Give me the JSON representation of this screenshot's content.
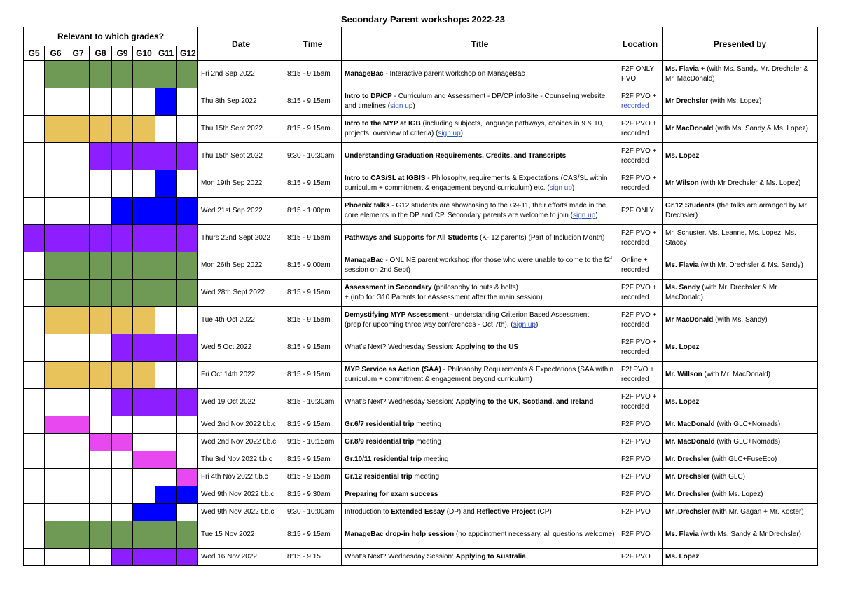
{
  "title": "Secondary Parent workshops 2022-23",
  "headers": {
    "relevant": "Relevant to which grades?",
    "grades": [
      "G5",
      "G6",
      "G7",
      "G8",
      "G9",
      "G10",
      "G11",
      "G12"
    ],
    "date": "Date",
    "time": "Time",
    "title": "Title",
    "location": "Location",
    "presented_by": "Presented by"
  },
  "colors": {
    "g": "#6f9a55",
    "y": "#e8c25b",
    "p": "#8d1eff",
    "b": "#0000ff",
    "m": "#e848ef",
    "link": "#2b4fbf"
  },
  "rows": [
    {
      "tall": true,
      "cells": [
        "w",
        "g",
        "g",
        "g",
        "g",
        "g",
        "g",
        "g"
      ],
      "date": "Fri 2nd Sep 2022",
      "time": "8:15 - 9:15am",
      "title": [
        {
          "t": "ManageBac",
          "s": "b"
        },
        {
          "t": " - Interactive parent workshop on ManageBac"
        }
      ],
      "location": [
        {
          "t": "F2F ONLY PVO"
        }
      ],
      "presenter": [
        {
          "t": "Ms. Flavia",
          "s": "b"
        },
        {
          "t": " + (with Ms. Sandy, Mr. Drechsler & Mr. MacDonald)"
        }
      ]
    },
    {
      "tall": true,
      "cells": [
        "w",
        "w",
        "w",
        "w",
        "w",
        "w",
        "b",
        "w"
      ],
      "date": "Thu 8th Sep 2022",
      "time": "8:15 - 9:15am",
      "title": [
        {
          "t": "Intro to DP/CP",
          "s": "b"
        },
        {
          "t": " - Curriculum and Assessment - DP/CP infoSite - Counseling website and timelines ("
        },
        {
          "t": "sign up",
          "s": "l"
        },
        {
          "t": ")"
        }
      ],
      "location": [
        {
          "t": "F2F PVO + "
        },
        {
          "t": "recorded",
          "s": "l"
        }
      ],
      "presenter": [
        {
          "t": "Mr Drechsler",
          "s": "b"
        },
        {
          "t": " (with Ms. Lopez)"
        }
      ]
    },
    {
      "tall": true,
      "cells": [
        "w",
        "y",
        "y",
        "y",
        "y",
        "y",
        "w",
        "w"
      ],
      "date": "Thu 15th Sept 2022",
      "time": "8:15 - 9:15am",
      "title": [
        {
          "t": "Intro to the MYP at IGB",
          "s": "b"
        },
        {
          "t": " (including subjects, language pathways, choices in 9 & 10, projects, overview of criteria) ("
        },
        {
          "t": "sign up",
          "s": "l"
        },
        {
          "t": ")"
        }
      ],
      "location": [
        {
          "t": "F2F PVO + recorded"
        }
      ],
      "presenter": [
        {
          "t": "Mr MacDonald",
          "s": "b"
        },
        {
          "t": " (with Ms. Sandy &  Ms. Lopez)"
        }
      ]
    },
    {
      "tall": true,
      "cells": [
        "w",
        "w",
        "w",
        "p",
        "p",
        "p",
        "p",
        "p"
      ],
      "date": "Thu 15th Sept 2022",
      "time": "9:30 - 10:30am",
      "title": [
        {
          "t": "Understanding Graduation Requirements, Credits, and Transcripts",
          "s": "b"
        }
      ],
      "location": [
        {
          "t": "F2F PVO + recorded"
        }
      ],
      "presenter": [
        {
          "t": "Ms. Lopez",
          "s": "b"
        }
      ]
    },
    {
      "tall": true,
      "cells": [
        "w",
        "w",
        "w",
        "w",
        "w",
        "w",
        "b",
        "w"
      ],
      "date": "Mon 19th Sep 2022",
      "time": "8:15 - 9:15am",
      "title": [
        {
          "t": "Intro to CAS/SL at IGBIS",
          "s": "b"
        },
        {
          "t": " - Philosophy, requirements & Expectations (CAS/SL within curriculum + commitment & engagement beyond curriculum) etc. ("
        },
        {
          "t": "sign up",
          "s": "l"
        },
        {
          "t": ")"
        }
      ],
      "location": [
        {
          "t": "F2F PVO + recorded"
        }
      ],
      "presenter": [
        {
          "t": "Mr Wilson",
          "s": "b"
        },
        {
          "t": "  (with Mr Drechsler & Ms. Lopez)"
        }
      ]
    },
    {
      "tall": true,
      "cells": [
        "w",
        "w",
        "w",
        "w",
        "b",
        "b",
        "b",
        "b"
      ],
      "date": "Wed 21st Sep 2022",
      "time": "8:15 - 1:00pm",
      "title": [
        {
          "t": "Phoenix talks",
          "s": "b"
        },
        {
          "t": " - G12 students are showcasing to the G9-11, their efforts made in the core elements in the DP and CP. Secondary parents are welcome to join ("
        },
        {
          "t": "sign up",
          "s": "l"
        },
        {
          "t": ")"
        }
      ],
      "location": [
        {
          "t": "F2F ONLY"
        }
      ],
      "presenter": [
        {
          "t": "Gr.12 Students",
          "s": "b"
        },
        {
          "t": " (the talks are arranged by Mr Drechsler)"
        }
      ]
    },
    {
      "tall": true,
      "cells": [
        "p",
        "p",
        "p",
        "p",
        "p",
        "p",
        "p",
        "p"
      ],
      "date": "Thurs 22nd Sept 2022",
      "time": "8:15 - 9:15am",
      "title": [
        {
          "t": "Pathways and Supports for All Students",
          "s": "b"
        },
        {
          "t": " (K- 12 parents) (Part of Inclusion Month)"
        }
      ],
      "location": [
        {
          "t": "F2F PVO + recorded"
        }
      ],
      "presenter": [
        {
          "t": "Mr. Schuster, Ms. Leanne, Ms. Lopez, Ms. Stacey"
        }
      ]
    },
    {
      "tall": true,
      "cells": [
        "w",
        "g",
        "g",
        "g",
        "g",
        "g",
        "g",
        "g"
      ],
      "date": "Mon 26th Sep 2022",
      "time": "8:15 - 9:00am",
      "title": [
        {
          "t": "ManagaBac",
          "s": "b"
        },
        {
          "t": " - ONLINE parent workshop (for those who were unable to come to the f2f session on 2nd Sept)"
        }
      ],
      "location": [
        {
          "t": "Online + recorded"
        }
      ],
      "presenter": [
        {
          "t": "Ms. Flavia",
          "s": "b"
        },
        {
          "t": " (with Mr. Drechsler & Ms. Sandy)"
        }
      ]
    },
    {
      "tall": true,
      "cells": [
        "w",
        "g",
        "g",
        "g",
        "g",
        "g",
        "g",
        "g"
      ],
      "date": "Wed 28th Sept 2022",
      "time": "8:15 - 9:15am",
      "title": [
        {
          "t": "Assessment in Secondary",
          "s": "b"
        },
        {
          "t": " (philosophy to nuts & bolts)"
        },
        {
          "t": "+    (info for G10 Parents for eAssessment after the main session)",
          "s": "n"
        }
      ],
      "location": [
        {
          "t": "F2F PVO + recorded"
        }
      ],
      "presenter": [
        {
          "t": "Ms. Sandy",
          "s": "b"
        },
        {
          "t": " (with Mr. Drechsler & Mr. MacDonald)"
        }
      ]
    },
    {
      "tall": true,
      "cells": [
        "w",
        "y",
        "y",
        "y",
        "y",
        "y",
        "w",
        "w"
      ],
      "date": "Tue 4th Oct 2022",
      "time": "8:15 - 9:15am",
      "title": [
        {
          "t": "Demystifying MYP Assessment",
          "s": "b"
        },
        {
          "t": " - understanding  Criterion Based Assessment"
        },
        {
          "t": "(prep for upcoming three way conferences - Oct 7th). (",
          "s": "n"
        },
        {
          "t": "sign up",
          "s": "l"
        },
        {
          "t": ")"
        }
      ],
      "location": [
        {
          "t": "F2F PVO + recorded"
        }
      ],
      "presenter": [
        {
          "t": "Mr MacDonald",
          "s": "b"
        },
        {
          "t": " (with Ms. Sandy)"
        }
      ]
    },
    {
      "tall": true,
      "cells": [
        "w",
        "w",
        "w",
        "w",
        "p",
        "p",
        "p",
        "p"
      ],
      "date": "Wed 5 Oct 2022",
      "time": "8:15 - 9:15am",
      "title": [
        {
          "t": "What’s Next? Wednesday Session: "
        },
        {
          "t": "Applying to the US",
          "s": "b"
        }
      ],
      "location": [
        {
          "t": "F2F PVO + recorded"
        }
      ],
      "presenter": [
        {
          "t": "Ms. Lopez",
          "s": "b"
        }
      ]
    },
    {
      "tall": true,
      "cells": [
        "w",
        "y",
        "y",
        "y",
        "y",
        "y",
        "w",
        "w"
      ],
      "date": "Fri Oct 14th 2022",
      "time": "8:15 - 9:15am",
      "title": [
        {
          "t": "MYP Service as Action (SAA)",
          "s": "b"
        },
        {
          "t": " - Philosophy Requirements & Expectations (SAA within curriculum + commitment & engagement beyond curriculum)"
        }
      ],
      "location": [
        {
          "t": "F2f PVO + recorded"
        }
      ],
      "presenter": [
        {
          "t": "Mr. Willson",
          "s": "b"
        },
        {
          "t": " (with Mr. MacDonald)"
        }
      ]
    },
    {
      "tall": true,
      "cells": [
        "w",
        "w",
        "w",
        "w",
        "p",
        "p",
        "p",
        "p"
      ],
      "date": "Wed 19 Oct  2022",
      "time": "8:15 - 10:30am",
      "title": [
        {
          "t": "What’s Next? Wednesday Session: "
        },
        {
          "t": "Applying to the UK, Scotland, and Ireland",
          "s": "b"
        }
      ],
      "location": [
        {
          "t": "F2F PVO + recorded"
        }
      ],
      "presenter": [
        {
          "t": "Ms. Lopez",
          "s": "b"
        }
      ]
    },
    {
      "tall": false,
      "cells": [
        "w",
        "m",
        "m",
        "w",
        "w",
        "w",
        "w",
        "w"
      ],
      "date": "Wed 2nd Nov 2022 t.b.c",
      "time": "8:15 - 9:15am",
      "title": [
        {
          "t": "Gr.6/7 residential trip",
          "s": "b"
        },
        {
          "t": " meeting"
        }
      ],
      "location": [
        {
          "t": "F2F PVO"
        }
      ],
      "presenter": [
        {
          "t": "Mr. MacDonald",
          "s": "b"
        },
        {
          "t": " (with GLC+Nomads)"
        }
      ]
    },
    {
      "tall": false,
      "cells": [
        "w",
        "w",
        "w",
        "m",
        "m",
        "w",
        "w",
        "w"
      ],
      "date": "Wed 2nd Nov 2022 t.b.c",
      "time": "9:15 - 10:15am",
      "title": [
        {
          "t": "Gr.8/9 residential trip",
          "s": "b"
        },
        {
          "t": " meeting"
        }
      ],
      "location": [
        {
          "t": "F2F PVO"
        }
      ],
      "presenter": [
        {
          "t": "Mr. MacDonald",
          "s": "b"
        },
        {
          "t": " (with GLC+Nomads)"
        }
      ]
    },
    {
      "tall": false,
      "cells": [
        "w",
        "w",
        "w",
        "w",
        "w",
        "m",
        "m",
        "w"
      ],
      "date": "Thu 3rd Nov 2022 t.b.c",
      "time": "8:15 - 9:15am",
      "title": [
        {
          "t": "Gr.10/11 residential trip",
          "s": "b"
        },
        {
          "t": " meeting"
        }
      ],
      "location": [
        {
          "t": "F2F PVO"
        }
      ],
      "presenter": [
        {
          "t": "Mr. Drechsler",
          "s": "b"
        },
        {
          "t": " (with GLC+FuseEco)"
        }
      ]
    },
    {
      "tall": false,
      "cells": [
        "w",
        "w",
        "w",
        "w",
        "w",
        "w",
        "w",
        "m"
      ],
      "date": "Fri 4th Nov 2022 t.b.c",
      "time": "8:15 - 9:15am",
      "title": [
        {
          "t": "Gr.12 residential trip",
          "s": "b"
        },
        {
          "t": " meeting"
        }
      ],
      "location": [
        {
          "t": "F2F PVO"
        }
      ],
      "presenter": [
        {
          "t": "Mr. Drechsler",
          "s": "b"
        },
        {
          "t": " (with GLC)"
        }
      ]
    },
    {
      "tall": false,
      "cells": [
        "w",
        "w",
        "w",
        "w",
        "w",
        "w",
        "b",
        "b"
      ],
      "date": "Wed 9th Nov 2022 t.b.c",
      "time": "8:15 - 9:30am",
      "title": [
        {
          "t": "Preparing for exam success",
          "s": "b"
        }
      ],
      "location": [
        {
          "t": "F2F PVO"
        }
      ],
      "presenter": [
        {
          "t": "Mr. Drechsler",
          "s": "b"
        },
        {
          "t": " (with Ms. Lopez)"
        }
      ]
    },
    {
      "tall": false,
      "cells": [
        "w",
        "w",
        "w",
        "w",
        "w",
        "b",
        "b",
        "w"
      ],
      "date": "Wed 9th Nov 2022 t.b.c",
      "time": "9:30 - 10:00am",
      "title": [
        {
          "t": "Introduction to "
        },
        {
          "t": "Extended Essay",
          "s": "b"
        },
        {
          "t": " (DP) and "
        },
        {
          "t": "Reflective Project",
          "s": "b"
        },
        {
          "t": " (CP)"
        }
      ],
      "location": [
        {
          "t": "F2F PVO"
        }
      ],
      "presenter": [
        {
          "t": "Mr .Drechsler",
          "s": "b"
        },
        {
          "t": " (with Mr. Gagan + Mr. Koster)"
        }
      ]
    },
    {
      "tall": true,
      "cells": [
        "w",
        "g",
        "g",
        "g",
        "g",
        "g",
        "g",
        "g"
      ],
      "date": "Tue 15 Nov 2022",
      "time": "8:15 - 9:15am",
      "title": [
        {
          "t": "ManageBac drop-in help session",
          "s": "b"
        },
        {
          "t": " (no appointment necessary, all questions welcome)"
        }
      ],
      "location": [
        {
          "t": "F2F PVO"
        }
      ],
      "presenter": [
        {
          "t": "Ms. Flavia",
          "s": "b"
        },
        {
          "t": " (with Ms. Sandy & Mr.Drechsler)"
        }
      ]
    },
    {
      "tall": false,
      "cells": [
        "w",
        "w",
        "w",
        "w",
        "p",
        "p",
        "p",
        "p"
      ],
      "date": "Wed 16 Nov 2022",
      "time": "8:15 - 9:15",
      "title": [
        {
          "t": "What’s Next? Wednesday Session: "
        },
        {
          "t": "Applying to Australia",
          "s": "b"
        }
      ],
      "location": [
        {
          "t": "F2F PVO"
        }
      ],
      "presenter": [
        {
          "t": "Ms. Lopez",
          "s": "b"
        }
      ]
    }
  ]
}
